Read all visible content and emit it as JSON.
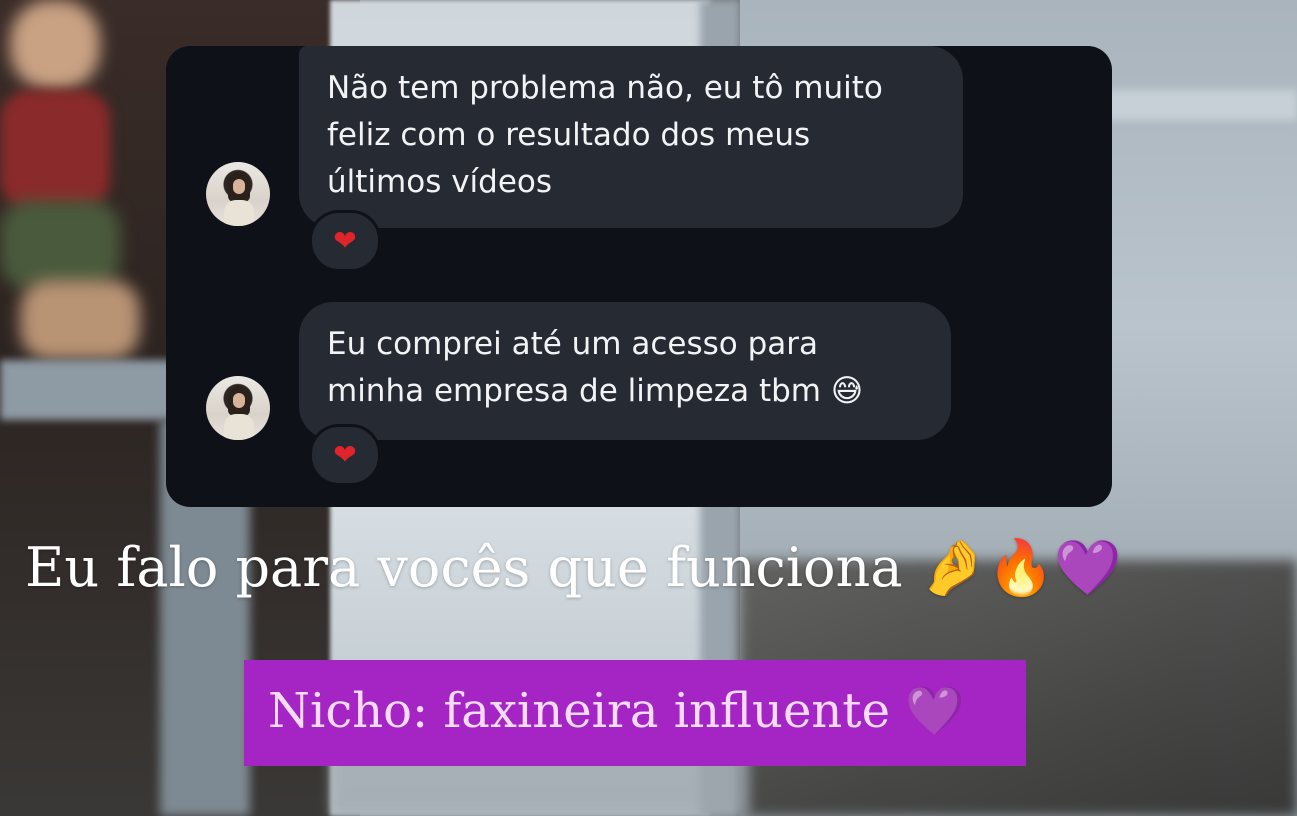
{
  "messages": [
    {
      "text": "Não tem problema não, eu tô muito\nfeliz com o resultado dos meus\núltimos vídeos",
      "reaction": "❤"
    },
    {
      "text": "Eu comprei até um acesso para\nminha empresa de limpeza tbm 😅",
      "reaction": "❤"
    }
  ],
  "caption": {
    "text": "Eu falo para vocês que funciona",
    "emojis": "🤌🔥💜"
  },
  "tag": {
    "text": "Nicho: faxineira influente",
    "emoji": "💜"
  },
  "colors": {
    "card_bg": "#0e1118",
    "bubble_bg": "#262a33",
    "tag_bg": "#a425c3",
    "heart": "#e0242a"
  }
}
